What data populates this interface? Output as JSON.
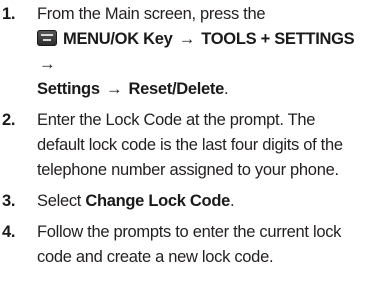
{
  "steps": [
    {
      "num": "1.",
      "intro": "From the Main screen, press the",
      "menu_key": "MENU/OK Key",
      "arrow": "→",
      "tools": "TOOLS + SETTINGS",
      "settings": "Settings",
      "reset": "Reset/Delete",
      "end": "."
    },
    {
      "num": "2.",
      "text": "Enter the Lock Code at the prompt. The default lock code is the last four digits of the telephone number assigned to your phone."
    },
    {
      "num": "3.",
      "pre": "Select ",
      "bold": "Change Lock Code",
      "end": "."
    },
    {
      "num": "4.",
      "text": "Follow the prompts to enter the current lock code and create a new lock code."
    }
  ],
  "icons": {
    "menu_key": "menu-ok-key-icon"
  }
}
